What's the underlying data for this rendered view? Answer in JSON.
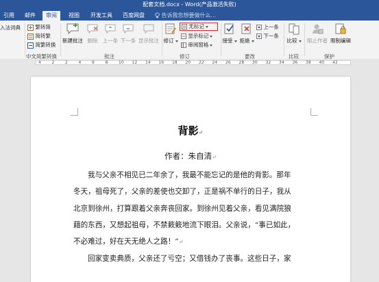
{
  "window": {
    "title": "配套文档.docx - Word(产品激活失败)"
  },
  "tabs": [
    {
      "label": "引用"
    },
    {
      "label": "邮件"
    },
    {
      "label": "审阅"
    },
    {
      "label": "视图"
    },
    {
      "label": "开发工具"
    },
    {
      "label": "百度网盘"
    }
  ],
  "tell_me": {
    "placeholder": "告诉我您想要做什么..."
  },
  "ribbon": {
    "dictionary": "入法词典",
    "chinese": {
      "trad_to_simp": "繁转简",
      "simp_to_trad": "简转繁",
      "convert": "简繁转换",
      "group": "中文简繁转换"
    },
    "comments": {
      "new": "新建批注",
      "delete": "删除",
      "previous": "上一条",
      "next": "下一条",
      "show": "显示批注",
      "group": "批注"
    },
    "tracking": {
      "track_changes": "修订",
      "markup_view": "无标记",
      "show_markup": "显示标记",
      "reviewing_pane": "审阅窗格",
      "group": "修订"
    },
    "changes": {
      "accept": "接受",
      "reject": "拒绝",
      "previous": "上一条",
      "next": "下一条",
      "group": "更改"
    },
    "compare": {
      "compare": "比较",
      "group": "比较"
    },
    "protect": {
      "block_authors": "阻止作者",
      "restrict_editing": "限制编辑",
      "group": "保护"
    }
  },
  "ruler": {
    "numbers": [
      "4",
      "2",
      "2",
      "4",
      "6",
      "8",
      "10",
      "12",
      "14",
      "16",
      "18",
      "20",
      "22",
      "24",
      "26",
      "28",
      "30",
      "32",
      "34",
      "36",
      "38",
      "40",
      "42"
    ]
  },
  "document": {
    "title": "背影",
    "author": "作者：朱自清",
    "lines": [
      "我与父亲不相见已二年余了，我最不能忘记的是他的背影。那年",
      "冬天，祖母死了，父亲的差使也交卸了，正是祸不单行的日子，我从",
      "北京到徐州，打算跟着父亲奔丧回家。到徐州见着父亲，看见满院狼",
      "藉的东西，又想起祖母，不禁簌簌地流下眼泪。父亲说，“事已如此，",
      "不必难过，好在天无绝人之路！”",
      "回家变卖典质，父亲还了亏空；又借钱办了丧事。这些日子，家"
    ]
  },
  "colors": {
    "accent": "#2b579a",
    "highlight_box": "#e01e1e"
  }
}
